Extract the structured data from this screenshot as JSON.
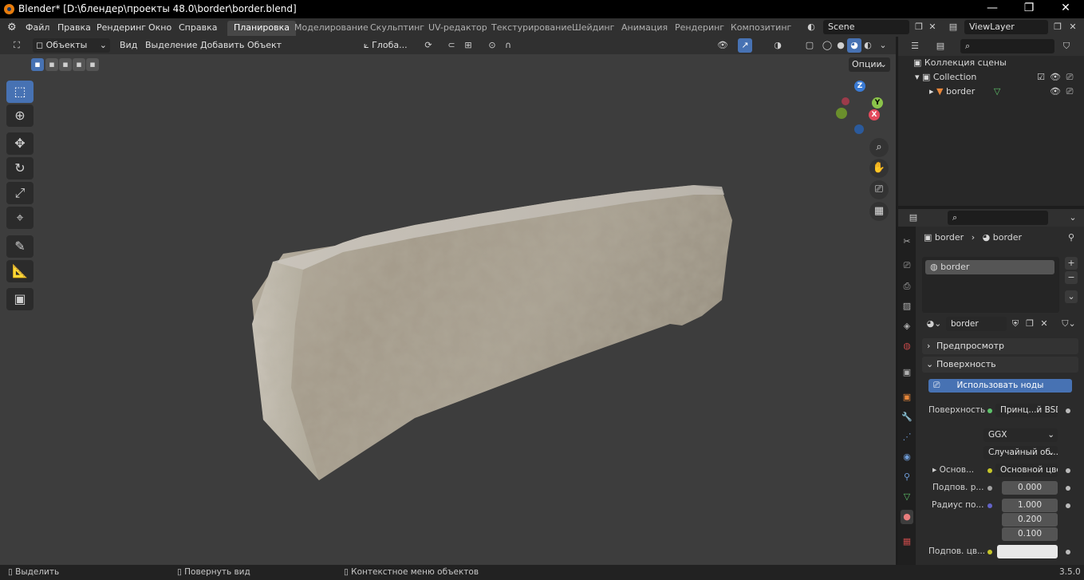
{
  "window": {
    "title": "Blender* [D:\\блендер\\проекты 48.0\\border\\border.blend]",
    "minimize": "—",
    "maximize": "❐",
    "close": "✕"
  },
  "menu": {
    "items": [
      "Файл",
      "Правка",
      "Рендеринг",
      "Окно",
      "Справка"
    ],
    "workspaces": [
      "Планировка",
      "Моделирование",
      "Скульптинг",
      "UV-редактор",
      "Текстурирование",
      "Шейдинг",
      "Анимация",
      "Рендеринг",
      "Композитинг"
    ],
    "active_workspace": 0,
    "scene": "Scene",
    "view_layer": "ViewLayer"
  },
  "viewport_header": {
    "mode": "Объекты",
    "menus": [
      "Вид",
      "Выделение",
      "Добавить",
      "Объект"
    ],
    "transform_orientation": "Глоба...",
    "options": "Опции"
  },
  "gizmo": {
    "z": "Z",
    "y": "Y",
    "x": "X"
  },
  "outliner": {
    "scene_collection": "Коллекция сцены",
    "collection": "Collection",
    "object": "border"
  },
  "properties": {
    "breadcrumb_object": "border",
    "breadcrumb_material": "border",
    "material_slot": "border",
    "material_name": "border",
    "panel_preview": "Предпросмотр",
    "panel_surface": "Поверхность",
    "use_nodes_button": "Использовать ноды",
    "surface_label": "Поверхность",
    "surface_value": "Принц...й BSDF",
    "distribution": "GGX",
    "subsurface_method": "Случайный об...",
    "base_color_label": "Основ...",
    "base_color_value": "Основной цвет",
    "subsurface_label": "Подпов. р...",
    "subsurface_value": "0.000",
    "radius_label": "Радиус по...",
    "radius_values": [
      "1.000",
      "0.200",
      "0.100"
    ],
    "subsurface_color_label": "Подпов. цв...",
    "subsurface_color": "#e8e8e8"
  },
  "statusbar": {
    "select": "Выделить",
    "rotate": "Повернуть вид",
    "context": "Контекстное меню объектов",
    "version": "3.5.0"
  },
  "colors": {
    "accent": "#4772b3",
    "viewport_bg": "#3d3d3d",
    "axis_x": "#e44a5c",
    "axis_y": "#8bc34a",
    "axis_z": "#3a7bd5"
  }
}
